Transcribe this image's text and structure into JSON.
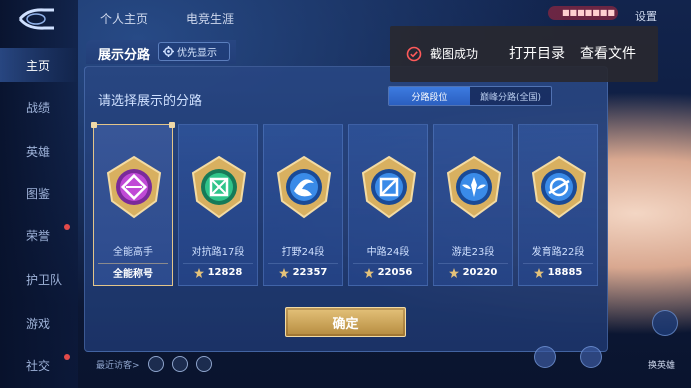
{
  "top_tabs": {
    "profile_home": "个人主页",
    "esports_career": "电竞生涯",
    "settings": "设置",
    "notice": "■■■■■■■"
  },
  "left_nav": {
    "items": [
      {
        "label": "主页",
        "active": true
      },
      {
        "label": "战绩",
        "active": false
      },
      {
        "label": "英雄",
        "active": false
      },
      {
        "label": "图鉴",
        "active": false
      },
      {
        "label": "荣誉",
        "active": false
      },
      {
        "label": "护卫队",
        "active": false
      },
      {
        "label": "游戏",
        "active": false
      },
      {
        "label": "社交",
        "active": false
      }
    ]
  },
  "panel": {
    "title": "展示分路",
    "priority_button": "优先显示",
    "prompt": "请选择展示的分路",
    "toggle": {
      "options": [
        "分路段位",
        "巅峰分路(全国)"
      ],
      "selected": "分路段位"
    },
    "lanes": [
      {
        "name": "全能高手",
        "title_label": "全能称号",
        "score": null,
        "selected": true,
        "icon": "all-rounder-badge-icon",
        "color": "#c04ad6"
      },
      {
        "name": "对抗路17段",
        "score": "12828",
        "selected": false,
        "icon": "clash-lane-badge-icon",
        "color": "#2fc48a"
      },
      {
        "name": "打野24段",
        "score": "22357",
        "selected": false,
        "icon": "jungle-badge-icon",
        "color": "#3a8be8"
      },
      {
        "name": "中路24段",
        "score": "22056",
        "selected": false,
        "icon": "mid-lane-badge-icon",
        "color": "#3a8be8"
      },
      {
        "name": "游走23段",
        "score": "20220",
        "selected": false,
        "icon": "roam-badge-icon",
        "color": "#3a8be8"
      },
      {
        "name": "发育路22段",
        "score": "18885",
        "selected": false,
        "icon": "farm-lane-badge-icon",
        "color": "#3a8be8"
      }
    ],
    "confirm_button": "确定"
  },
  "toast": {
    "status_text": "截图成功",
    "open_folder": "打开目录",
    "view_file": "查看文件",
    "icon": "check-circle-icon"
  },
  "bottom": {
    "visitor_text": "最近访客>",
    "right_label": "换英雄"
  },
  "colors": {
    "accent_gold": "#e4c27a",
    "panel_bg": "#2c4c8e",
    "toggle_active": "#3d7be0"
  }
}
